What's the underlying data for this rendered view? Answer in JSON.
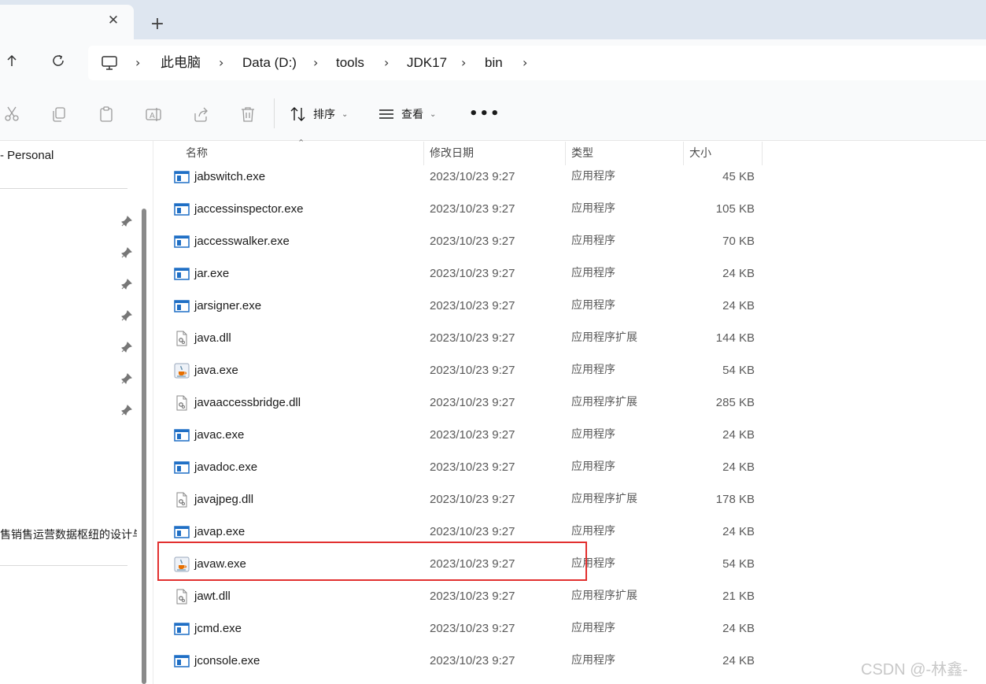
{
  "tabbar": {
    "close_glyph": "✕",
    "new_tab_glyph": "+"
  },
  "nav": {
    "up_icon": "arrow-up-icon",
    "refresh_icon": "refresh-icon"
  },
  "breadcrumb": [
    "此电脑",
    "Data (D:)",
    "tools",
    "JDK17",
    "bin"
  ],
  "toolbar": {
    "sort_label": "排序",
    "view_label": "查看",
    "more_label": "•••"
  },
  "sidebar": {
    "personal_label": "- Personal",
    "folder_label": "售销售运营数据枢纽的设计与"
  },
  "columns": {
    "name": "名称",
    "date": "修改日期",
    "type": "类型",
    "size": "大小"
  },
  "files": [
    {
      "name": "jabswitch.exe",
      "date": "2023/10/23 9:27",
      "type": "应用程序",
      "size": "45 KB",
      "icon": "exe"
    },
    {
      "name": "jaccessinspector.exe",
      "date": "2023/10/23 9:27",
      "type": "应用程序",
      "size": "105 KB",
      "icon": "exe"
    },
    {
      "name": "jaccesswalker.exe",
      "date": "2023/10/23 9:27",
      "type": "应用程序",
      "size": "70 KB",
      "icon": "exe"
    },
    {
      "name": "jar.exe",
      "date": "2023/10/23 9:27",
      "type": "应用程序",
      "size": "24 KB",
      "icon": "exe"
    },
    {
      "name": "jarsigner.exe",
      "date": "2023/10/23 9:27",
      "type": "应用程序",
      "size": "24 KB",
      "icon": "exe"
    },
    {
      "name": "java.dll",
      "date": "2023/10/23 9:27",
      "type": "应用程序扩展",
      "size": "144 KB",
      "icon": "dll"
    },
    {
      "name": "java.exe",
      "date": "2023/10/23 9:27",
      "type": "应用程序",
      "size": "54 KB",
      "icon": "java"
    },
    {
      "name": "javaaccessbridge.dll",
      "date": "2023/10/23 9:27",
      "type": "应用程序扩展",
      "size": "285 KB",
      "icon": "dll"
    },
    {
      "name": "javac.exe",
      "date": "2023/10/23 9:27",
      "type": "应用程序",
      "size": "24 KB",
      "icon": "exe"
    },
    {
      "name": "javadoc.exe",
      "date": "2023/10/23 9:27",
      "type": "应用程序",
      "size": "24 KB",
      "icon": "exe"
    },
    {
      "name": "javajpeg.dll",
      "date": "2023/10/23 9:27",
      "type": "应用程序扩展",
      "size": "178 KB",
      "icon": "dll"
    },
    {
      "name": "javap.exe",
      "date": "2023/10/23 9:27",
      "type": "应用程序",
      "size": "24 KB",
      "icon": "exe"
    },
    {
      "name": "javaw.exe",
      "date": "2023/10/23 9:27",
      "type": "应用程序",
      "size": "54 KB",
      "icon": "java"
    },
    {
      "name": "jawt.dll",
      "date": "2023/10/23 9:27",
      "type": "应用程序扩展",
      "size": "21 KB",
      "icon": "dll"
    },
    {
      "name": "jcmd.exe",
      "date": "2023/10/23 9:27",
      "type": "应用程序",
      "size": "24 KB",
      "icon": "exe"
    },
    {
      "name": "jconsole.exe",
      "date": "2023/10/23 9:27",
      "type": "应用程序",
      "size": "24 KB",
      "icon": "exe"
    }
  ],
  "watermark": "CSDN @-林鑫-",
  "colors": {
    "highlight": "#e2302f",
    "tabbar": "#dee6f0",
    "exe_icon_blue": "#1f6fc5"
  }
}
